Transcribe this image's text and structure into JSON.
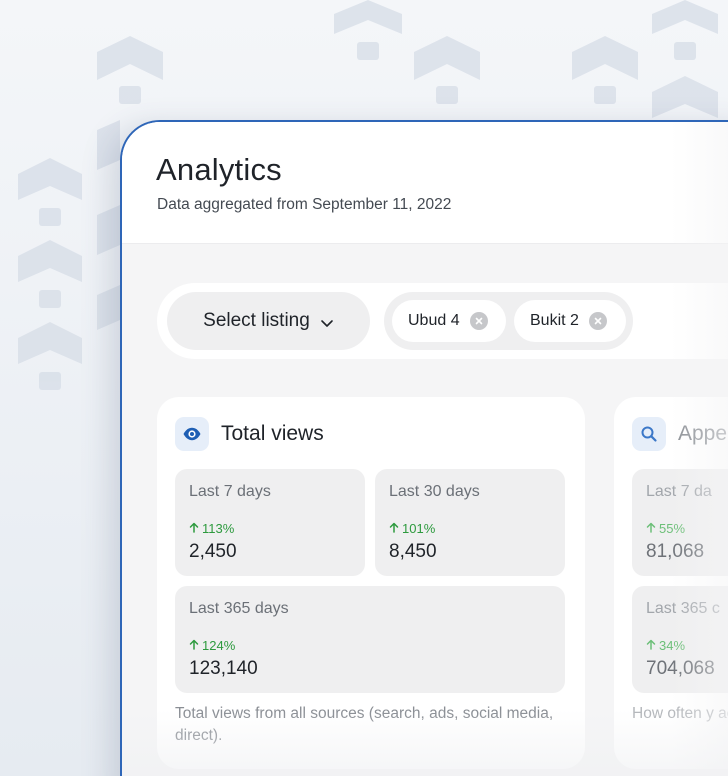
{
  "page": {
    "title": "Analytics",
    "subtitle": "Data aggregated from September 11, 2022"
  },
  "filters": {
    "select_label": "Select listing",
    "chips": [
      {
        "label": "Ubud 4"
      },
      {
        "label": "Bukit 2"
      }
    ]
  },
  "cards": [
    {
      "title": "Total views",
      "icon": "eye-icon",
      "stats": [
        {
          "label": "Last 7 days",
          "change": "113%",
          "value": "2,450"
        },
        {
          "label": "Last 30 days",
          "change": "101%",
          "value": "8,450"
        },
        {
          "label": "Last 365 days",
          "change": "124%",
          "value": "123,140"
        }
      ],
      "description": "Total views from all sources (search, ads, social media, direct)."
    },
    {
      "title": "Appe",
      "icon": "search-icon",
      "stats": [
        {
          "label": "Last 7 da",
          "change": "55%",
          "value": "81,068"
        },
        {
          "label": "Last 365 c",
          "change": "34%",
          "value": "704,068"
        }
      ],
      "description": "How often y across all c"
    }
  ],
  "colors": {
    "accent_blue": "#1f5fb4",
    "positive_green": "#2d9a3e",
    "window_border": "#2e66b8"
  }
}
